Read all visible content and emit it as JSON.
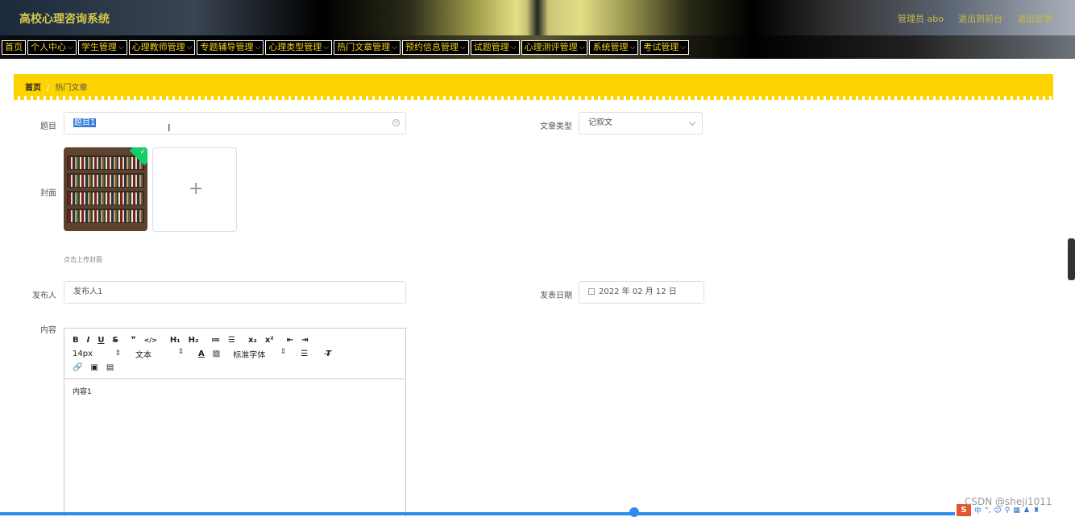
{
  "header": {
    "title": "高校心理咨询系统",
    "admin": "管理员 abo",
    "back_front": "退出到前台",
    "logout": "退出登录"
  },
  "nav": [
    {
      "label": "首页",
      "dropdown": false
    },
    {
      "label": "个人中心",
      "dropdown": true
    },
    {
      "label": "学生管理",
      "dropdown": true
    },
    {
      "label": "心理教师管理",
      "dropdown": true
    },
    {
      "label": "专题辅导管理",
      "dropdown": true
    },
    {
      "label": "心理类型管理",
      "dropdown": true
    },
    {
      "label": "热门文章管理",
      "dropdown": true
    },
    {
      "label": "预约信息管理",
      "dropdown": true
    },
    {
      "label": "试题管理",
      "dropdown": true
    },
    {
      "label": "心理测评管理",
      "dropdown": true
    },
    {
      "label": "系统管理",
      "dropdown": true
    },
    {
      "label": "考试管理",
      "dropdown": true
    }
  ],
  "breadcrumb": {
    "home": "首页",
    "separator": "/",
    "current": "热门文章"
  },
  "form": {
    "title_label": "题目",
    "title_value": "题目1",
    "type_label": "文章类型",
    "type_value": "记叙文",
    "cover_label": "封面",
    "cover_hint": "点击上传封面",
    "publisher_label": "发布人",
    "publisher_value": "发布人1",
    "date_label": "发表日期",
    "date_value": "2022 年 02 月 12 日",
    "content_label": "内容"
  },
  "editor": {
    "toolbar_row1": [
      "B",
      "I",
      "U",
      "S",
      "❞",
      "</>",
      "H₁",
      "H₂",
      "≔",
      "☰",
      "x₂",
      "x²",
      "⇤",
      "⇥"
    ],
    "font_size": "14px",
    "text_type": "文本",
    "font_family": "标准字体",
    "content": "内容1"
  },
  "watermark": "CSDN @sheji1011",
  "tray": {
    "ime": "中"
  },
  "colors": {
    "accent_yellow": "#fdd300",
    "nav_text": "#f0d020",
    "header_text": "#d7c94a",
    "progress_blue": "#2d8cf0"
  }
}
